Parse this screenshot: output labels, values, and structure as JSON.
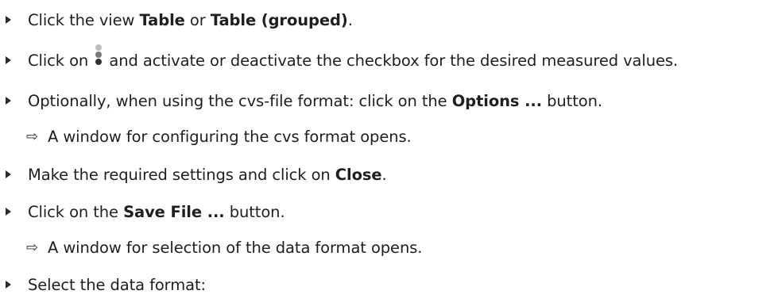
{
  "steps": [
    {
      "prefix": "Click the view ",
      "bold1": "Table",
      "middle": " or ",
      "bold2": "Table (grouped)",
      "suffix": "."
    },
    {
      "prefix": "Click on ",
      "icon": "vertical-dots-menu-icon",
      "suffix": " and activate or deactivate the checkbox for the desired measured values."
    },
    {
      "prefix": "Optionally, when using the cvs-file format: click on the ",
      "bold": "Options ...",
      "suffix": " button."
    },
    {
      "result": "A window for configuring the cvs format opens."
    },
    {
      "prefix": "Make the required settings and click on ",
      "bold": "Close",
      "suffix": "."
    },
    {
      "prefix": "Click on the ",
      "bold": "Save File ...",
      "suffix": " button."
    },
    {
      "result": "A window for selection of the data format opens."
    },
    {
      "text": "Select the data format:"
    }
  ],
  "symbols": {
    "result_arrow": "⇨"
  }
}
